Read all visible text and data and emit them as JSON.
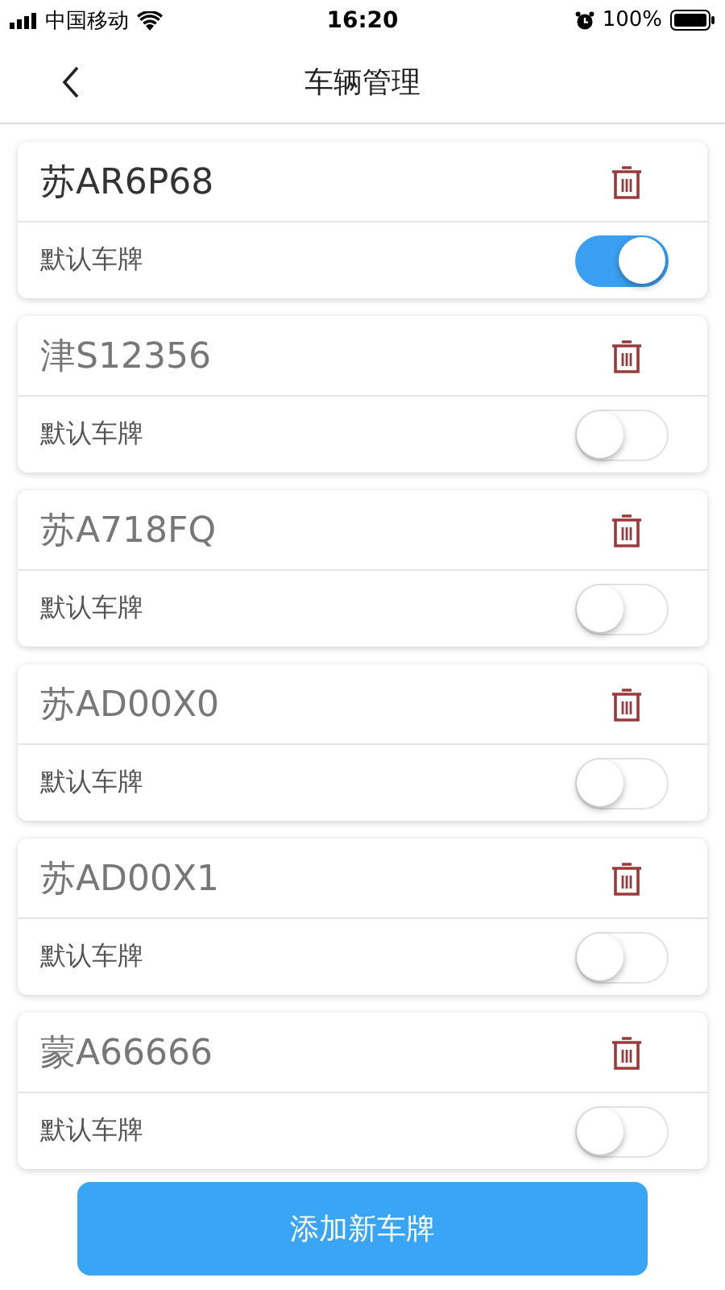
{
  "status_bar": {
    "carrier": "中国移动",
    "time": "16:20",
    "battery": "100%"
  },
  "nav": {
    "title": "车辆管理"
  },
  "vehicles": [
    {
      "plate": "苏AR6P68",
      "label": "默认车牌",
      "on": true
    },
    {
      "plate": "津S12356",
      "label": "默认车牌",
      "on": false
    },
    {
      "plate": "苏A718FQ",
      "label": "默认车牌",
      "on": false
    },
    {
      "plate": "苏AD00X0",
      "label": "默认车牌",
      "on": false
    },
    {
      "plate": "苏AD00X1",
      "label": "默认车牌",
      "on": false
    },
    {
      "plate": "蒙A66666",
      "label": "默认车牌",
      "on": false
    }
  ],
  "add_button": "添加新车牌"
}
